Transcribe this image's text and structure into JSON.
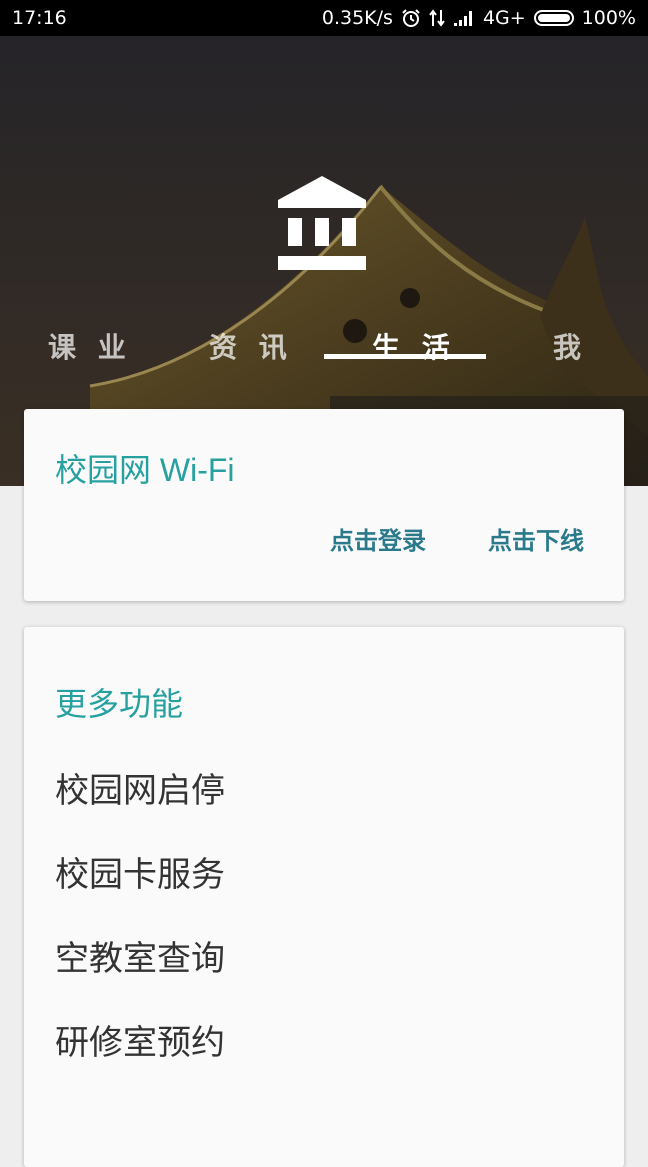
{
  "status_bar": {
    "time": "17:16",
    "speed": "0.35K/s",
    "network": "4G+",
    "battery": "100%"
  },
  "tabs": [
    "课 业",
    "资 讯",
    "生 活",
    "我"
  ],
  "active_tab": 2,
  "wifi_card": {
    "title": "校园网 Wi-Fi",
    "login_label": "点击登录",
    "logout_label": "点击下线"
  },
  "more_card": {
    "title": "更多功能",
    "items": [
      "校园网启停",
      "校园卡服务",
      "空教室查询",
      "研修室预约"
    ]
  },
  "colors": {
    "accent": "#26a1a0",
    "action": "#2b7a8c"
  }
}
